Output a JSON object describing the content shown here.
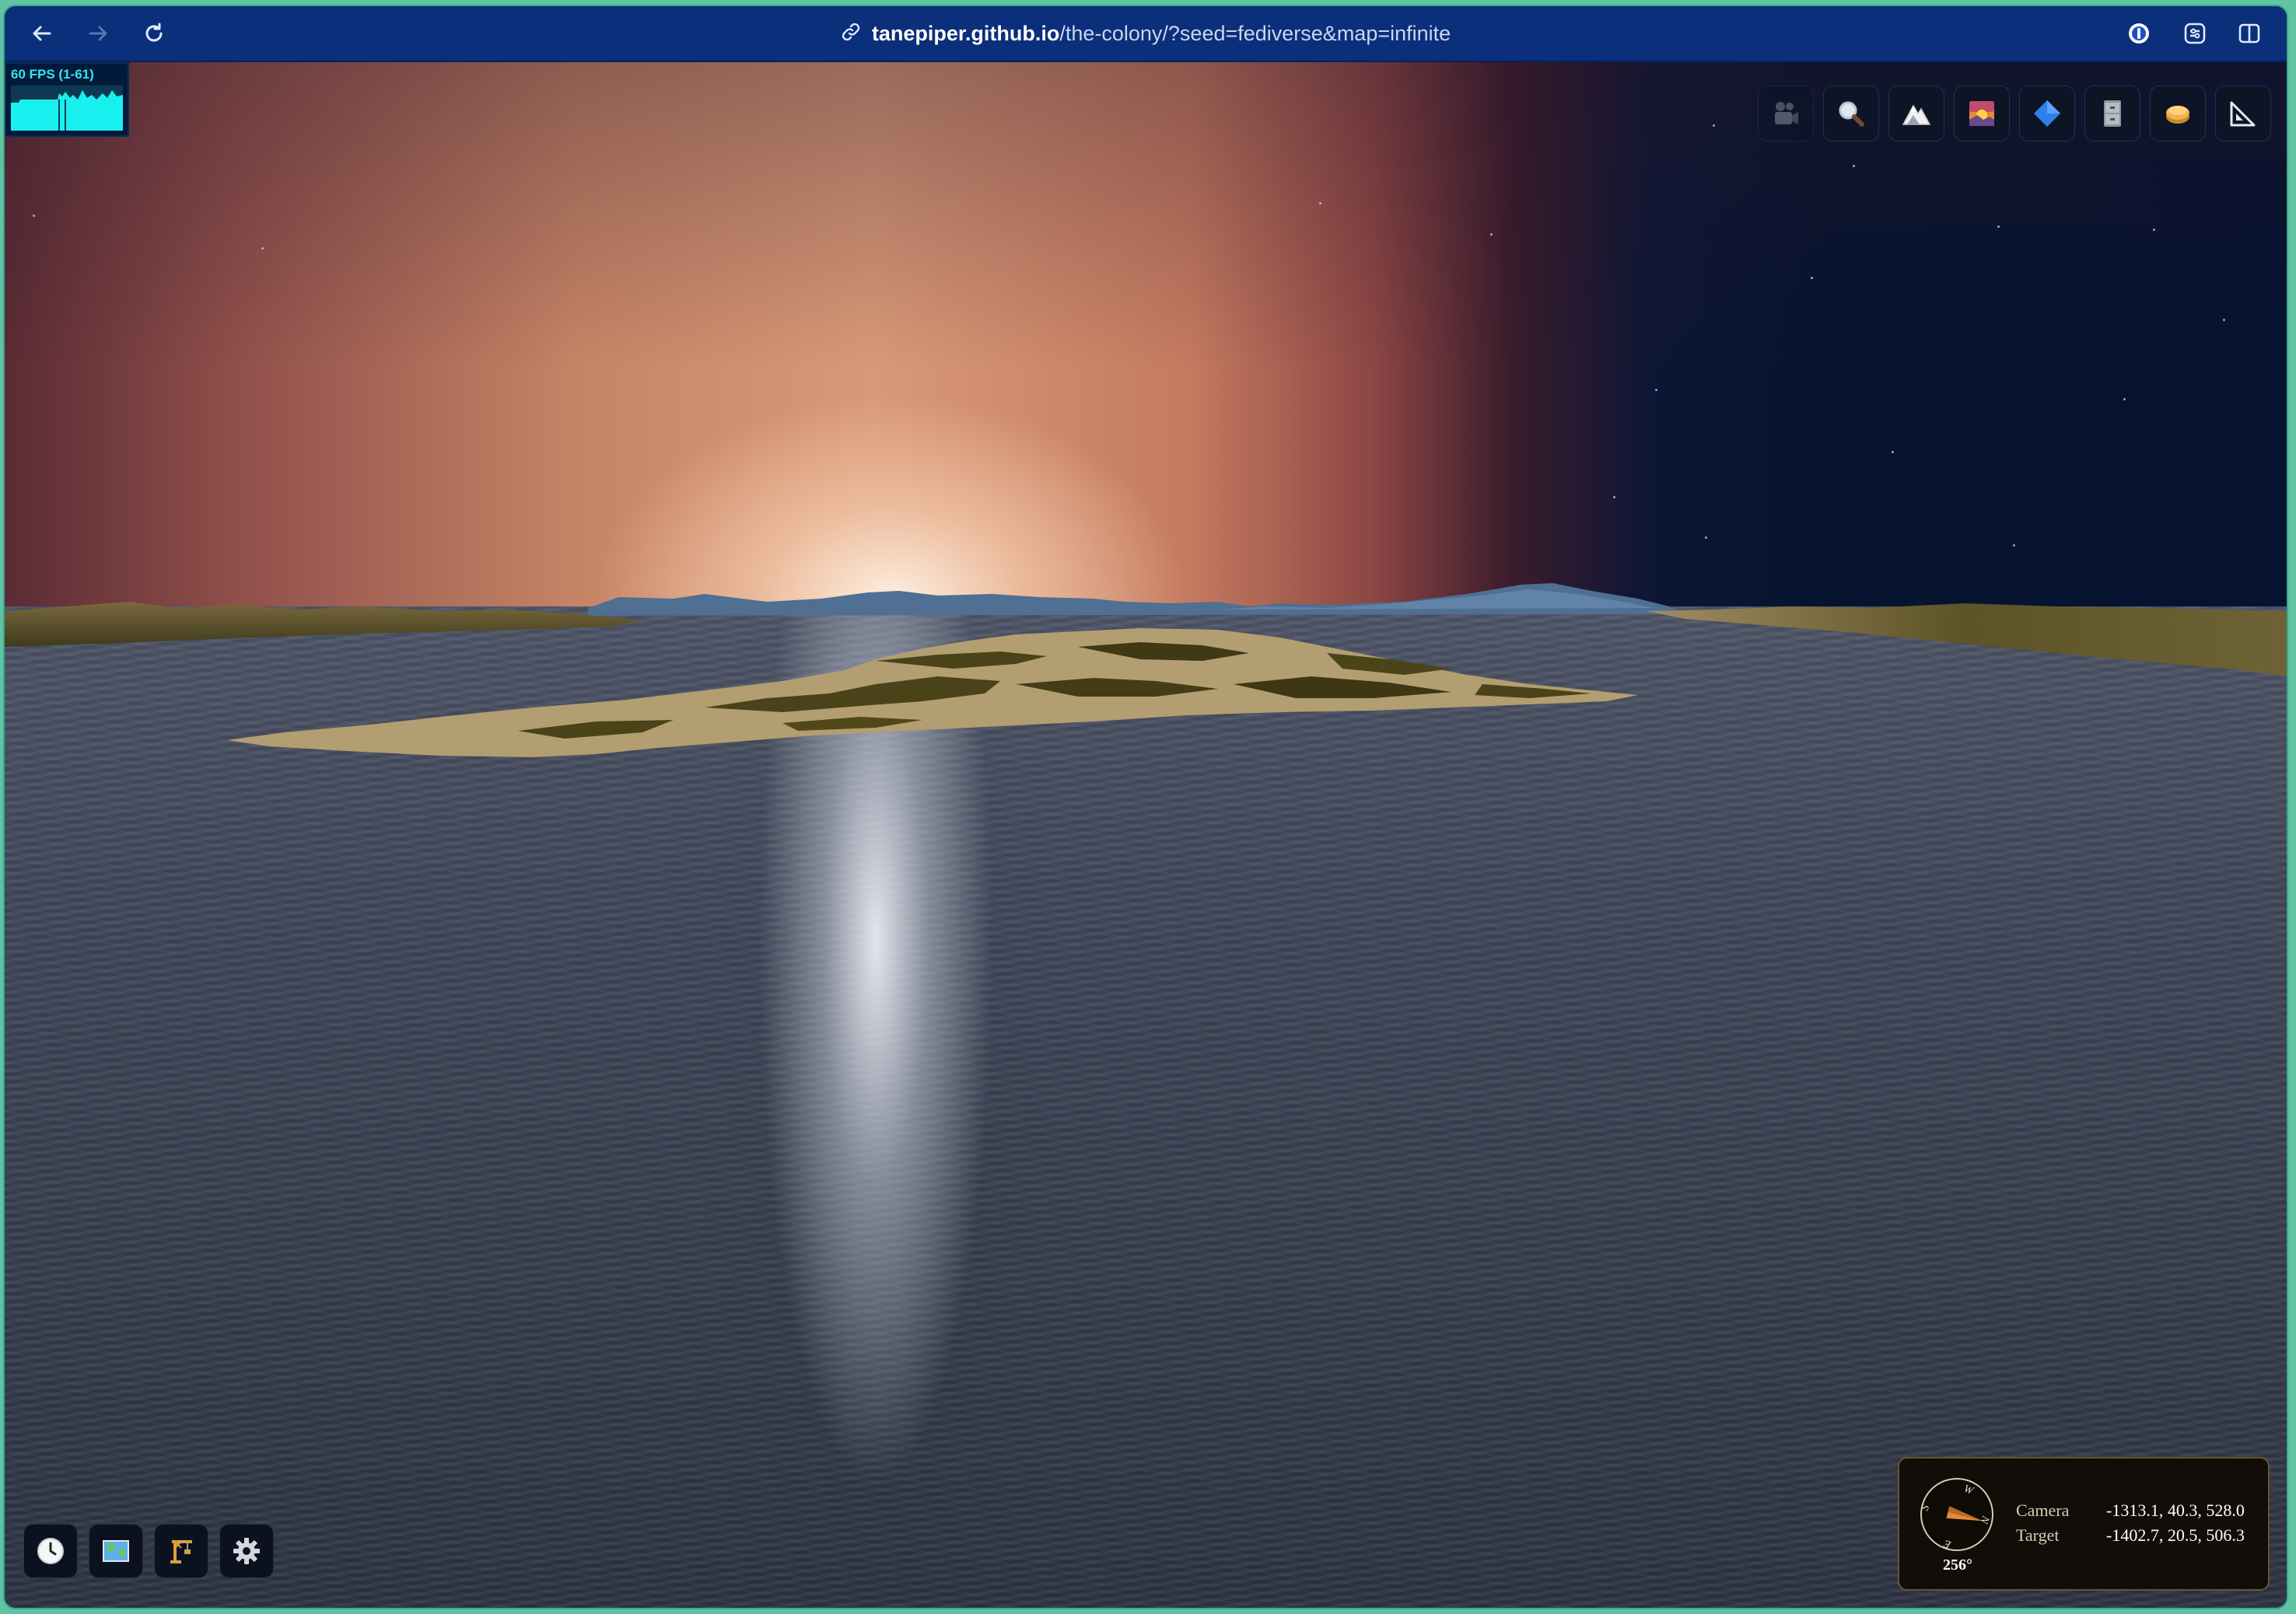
{
  "browser": {
    "url_host": "tanepiper.github.io",
    "url_path": "/the-colony/?seed=fediverse&map=infinite",
    "icons": [
      "back-arrow-icon",
      "forward-arrow-icon",
      "reload-icon",
      "link-icon",
      "password-manager-icon",
      "extension-icon",
      "sidebar-icon"
    ]
  },
  "fps_meter": {
    "label": "60 FPS (1-61)",
    "color": "#33e6ea"
  },
  "top_tools": [
    {
      "name": "camera-tool",
      "icon": "movie-camera-icon"
    },
    {
      "name": "zoom-tool",
      "icon": "magnifier-icon"
    },
    {
      "name": "terrain-tool",
      "icon": "mountain-icon"
    },
    {
      "name": "sky-tool",
      "icon": "sunrise-icon"
    },
    {
      "name": "water-tool",
      "icon": "blue-diamond-icon"
    },
    {
      "name": "storage-tool",
      "icon": "cabinet-icon"
    },
    {
      "name": "layers-tool",
      "icon": "cookie-icon"
    },
    {
      "name": "measure-tool",
      "icon": "ruler-triangle-icon"
    }
  ],
  "bottom_tools": [
    {
      "name": "time-button",
      "icon": "clock-icon"
    },
    {
      "name": "map-button",
      "icon": "map-icon"
    },
    {
      "name": "build-button",
      "icon": "construction-icon"
    },
    {
      "name": "settings-button",
      "icon": "gear-icon"
    }
  ],
  "camera_panel": {
    "heading": "256°",
    "compass_letters": [
      "W",
      "S",
      "E",
      "N"
    ],
    "camera_label": "Camera",
    "camera_value": "-1313.1, 40.3, 528.0",
    "target_label": "Target",
    "target_value": "-1402.7, 20.5, 506.3"
  }
}
